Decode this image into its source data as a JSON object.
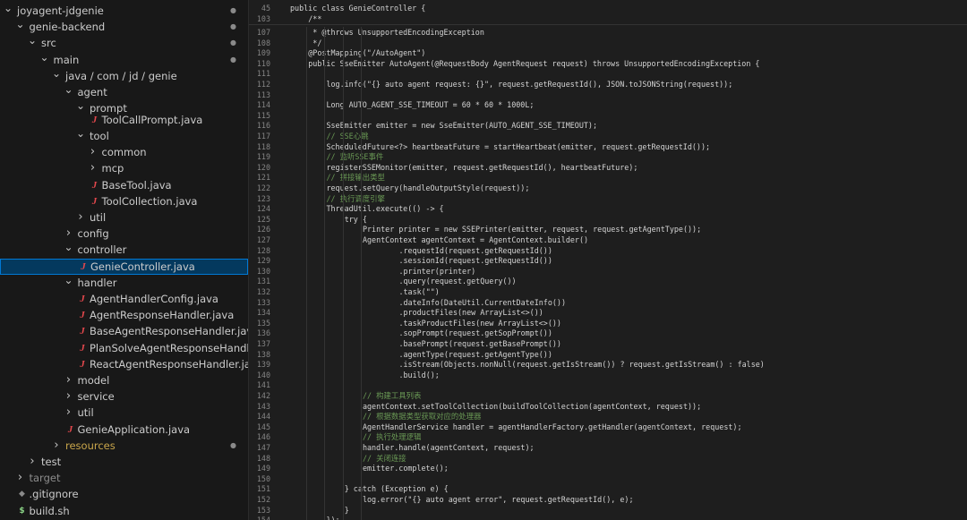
{
  "explorer": {
    "items": [
      {
        "label": "joyagent-jdgenie",
        "chevron": "down",
        "level": 0,
        "dot": true
      },
      {
        "label": "genie-backend",
        "chevron": "down",
        "level": 1,
        "dot": true
      },
      {
        "label": "src",
        "chevron": "down",
        "level": 2,
        "dot": true
      },
      {
        "label": "main",
        "chevron": "down",
        "level": 3,
        "dot": true
      },
      {
        "label": "java / com / jd / genie",
        "chevron": "down",
        "level": 4
      },
      {
        "label": "agent",
        "chevron": "down",
        "level": 5
      },
      {
        "label": "prompt",
        "chevron": "down",
        "level": 6
      },
      {
        "label": "ToolCallPrompt.java",
        "icon": "java",
        "level": 7,
        "partial": true
      },
      {
        "label": "tool",
        "chevron": "down",
        "level": 6
      },
      {
        "label": "common",
        "chevron": "right",
        "level": 7
      },
      {
        "label": "mcp",
        "chevron": "right",
        "level": 7
      },
      {
        "label": "BaseTool.java",
        "icon": "java",
        "level": 7
      },
      {
        "label": "ToolCollection.java",
        "icon": "java",
        "level": 7
      },
      {
        "label": "util",
        "chevron": "right",
        "level": 6
      },
      {
        "label": "config",
        "chevron": "right",
        "level": 5
      },
      {
        "label": "controller",
        "chevron": "down",
        "level": 5
      },
      {
        "label": "GenieController.java",
        "icon": "java",
        "level": 6,
        "selected": true
      },
      {
        "label": "handler",
        "chevron": "down",
        "level": 5
      },
      {
        "label": "AgentHandlerConfig.java",
        "icon": "java",
        "level": 6
      },
      {
        "label": "AgentResponseHandler.java",
        "icon": "java",
        "level": 6
      },
      {
        "label": "BaseAgentResponseHandler.java",
        "icon": "java",
        "level": 6
      },
      {
        "label": "PlanSolveAgentResponseHandler.java",
        "icon": "java",
        "level": 6
      },
      {
        "label": "ReactAgentResponseHandler.java",
        "icon": "java",
        "level": 6
      },
      {
        "label": "model",
        "chevron": "right",
        "level": 5
      },
      {
        "label": "service",
        "chevron": "right",
        "level": 5
      },
      {
        "label": "util",
        "chevron": "right",
        "level": 5
      },
      {
        "label": "GenieApplication.java",
        "icon": "java",
        "level": 5
      },
      {
        "label": "resources",
        "chevron": "right",
        "level": 4,
        "dot": true,
        "tone": "mod"
      },
      {
        "label": "test",
        "chevron": "right",
        "level": 2
      },
      {
        "label": "target",
        "chevron": "right",
        "level": 1,
        "tone": "dim"
      },
      {
        "label": ".gitignore",
        "icon": "git",
        "level": 1
      },
      {
        "label": "build.sh",
        "icon": "sh",
        "level": 1
      }
    ]
  },
  "editor": {
    "lines": [
      {
        "n": "45",
        "indent": 0,
        "text": "public class GenieController {"
      },
      {
        "n": "103",
        "indent": 1,
        "text": "/**"
      },
      {
        "n": "107",
        "indent": 1,
        "text": " * @throws UnsupportedEncodingException"
      },
      {
        "n": "108",
        "indent": 1,
        "text": " */"
      },
      {
        "n": "109",
        "indent": 1,
        "text": "@PostMapping(\"/AutoAgent\")"
      },
      {
        "n": "110",
        "indent": 1,
        "text": "public SseEmitter AutoAgent(@RequestBody AgentRequest request) throws UnsupportedEncodingException {"
      },
      {
        "n": "111",
        "indent": 0,
        "text": ""
      },
      {
        "n": "112",
        "indent": 2,
        "text": "log.info(\"{} auto agent request: {}\", request.getRequestId(), JSON.toJSONString(request));"
      },
      {
        "n": "113",
        "indent": 0,
        "text": ""
      },
      {
        "n": "114",
        "indent": 2,
        "text": "Long AUTO_AGENT_SSE_TIMEOUT = 60 * 60 * 1000L;"
      },
      {
        "n": "115",
        "indent": 0,
        "text": ""
      },
      {
        "n": "116",
        "indent": 2,
        "text": "SseEmitter emitter = new SseEmitter(AUTO_AGENT_SSE_TIMEOUT);"
      },
      {
        "n": "117",
        "indent": 2,
        "text": "// SSE心跳",
        "comment": true
      },
      {
        "n": "118",
        "indent": 2,
        "text": "ScheduledFuture<?> heartbeatFuture = startHeartbeat(emitter, request.getRequestId());"
      },
      {
        "n": "119",
        "indent": 2,
        "text": "// 监听SSE事件",
        "comment": true
      },
      {
        "n": "120",
        "indent": 2,
        "text": "registerSSEMonitor(emitter, request.getRequestId(), heartbeatFuture);"
      },
      {
        "n": "121",
        "indent": 2,
        "text": "// 拼接输出类型",
        "comment": true
      },
      {
        "n": "122",
        "indent": 2,
        "text": "request.setQuery(handleOutputStyle(request));"
      },
      {
        "n": "123",
        "indent": 2,
        "text": "// 执行调度引擎",
        "comment": true
      },
      {
        "n": "124",
        "indent": 2,
        "text": "ThreadUtil.execute(() -> {"
      },
      {
        "n": "125",
        "indent": 3,
        "text": "try {"
      },
      {
        "n": "126",
        "indent": 4,
        "text": "Printer printer = new SSEPrinter(emitter, request, request.getAgentType());"
      },
      {
        "n": "127",
        "indent": 4,
        "text": "AgentContext agentContext = AgentContext.builder()"
      },
      {
        "n": "128",
        "indent": 6,
        "text": ".requestId(request.getRequestId())"
      },
      {
        "n": "129",
        "indent": 6,
        "text": ".sessionId(request.getRequestId())"
      },
      {
        "n": "130",
        "indent": 6,
        "text": ".printer(printer)"
      },
      {
        "n": "131",
        "indent": 6,
        "text": ".query(request.getQuery())"
      },
      {
        "n": "132",
        "indent": 6,
        "text": ".task(\"\")"
      },
      {
        "n": "133",
        "indent": 6,
        "text": ".dateInfo(DateUtil.CurrentDateInfo())"
      },
      {
        "n": "134",
        "indent": 6,
        "text": ".productFiles(new ArrayList<>())"
      },
      {
        "n": "135",
        "indent": 6,
        "text": ".taskProductFiles(new ArrayList<>())"
      },
      {
        "n": "136",
        "indent": 6,
        "text": ".sopPrompt(request.getSopPrompt())"
      },
      {
        "n": "137",
        "indent": 6,
        "text": ".basePrompt(request.getBasePrompt())"
      },
      {
        "n": "138",
        "indent": 6,
        "text": ".agentType(request.getAgentType())"
      },
      {
        "n": "139",
        "indent": 6,
        "text": ".isStream(Objects.nonNull(request.getIsStream()) ? request.getIsStream() : false)"
      },
      {
        "n": "140",
        "indent": 6,
        "text": ".build();"
      },
      {
        "n": "141",
        "indent": 0,
        "text": ""
      },
      {
        "n": "142",
        "indent": 4,
        "text": "// 构建工具列表",
        "comment": true
      },
      {
        "n": "143",
        "indent": 4,
        "text": "agentContext.setToolCollection(buildToolCollection(agentContext, request));"
      },
      {
        "n": "144",
        "indent": 4,
        "text": "// 根据数据类型获取对应的处理器",
        "comment": true
      },
      {
        "n": "145",
        "indent": 4,
        "text": "AgentHandlerService handler = agentHandlerFactory.getHandler(agentContext, request);"
      },
      {
        "n": "146",
        "indent": 4,
        "text": "// 执行处理逻辑",
        "comment": true
      },
      {
        "n": "147",
        "indent": 4,
        "text": "handler.handle(agentContext, request);"
      },
      {
        "n": "148",
        "indent": 4,
        "text": "// 关闭连接",
        "comment": true
      },
      {
        "n": "149",
        "indent": 4,
        "text": "emitter.complete();"
      },
      {
        "n": "150",
        "indent": 0,
        "text": ""
      },
      {
        "n": "151",
        "indent": 3,
        "text": "} catch (Exception e) {"
      },
      {
        "n": "152",
        "indent": 4,
        "text": "log.error(\"{} auto agent error\", request.getRequestId(), e);"
      },
      {
        "n": "153",
        "indent": 3,
        "text": "}"
      },
      {
        "n": "154",
        "indent": 2,
        "text": "});"
      }
    ]
  }
}
